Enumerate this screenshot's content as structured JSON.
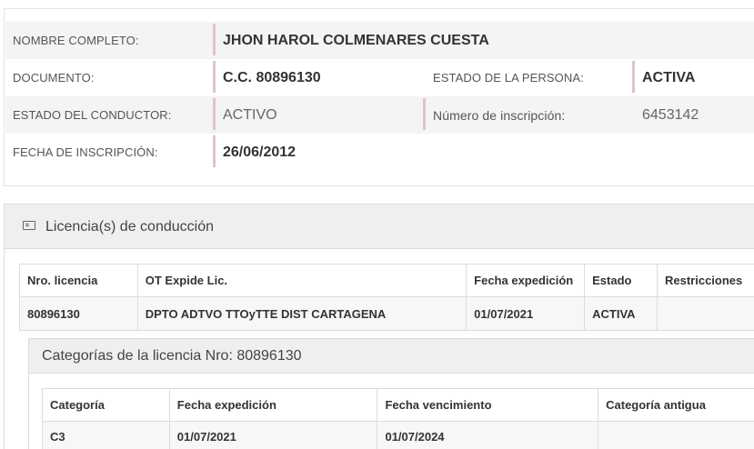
{
  "person": {
    "nombre_label": "NOMBRE COMPLETO:",
    "nombre_value": "JHON HAROL COLMENARES CUESTA",
    "documento_label": "DOCUMENTO:",
    "documento_value": "C.C. 80896130",
    "estado_persona_label": "ESTADO DE LA PERSONA:",
    "estado_persona_value": "ACTIVA",
    "estado_conductor_label": "ESTADO DEL CONDUCTOR:",
    "estado_conductor_value": "ACTIVO",
    "inscripcion_num_label": "Número de inscripción:",
    "inscripcion_num_value": "6453142",
    "fecha_inscripcion_label": "FECHA DE INSCRIPCIÓN:",
    "fecha_inscripcion_value": "26/06/2012"
  },
  "licencias": {
    "title": "Licencia(s) de conducción",
    "icon": "id-card-icon",
    "columns": [
      "Nro. licencia",
      "OT Expide Lic.",
      "Fecha expedición",
      "Estado",
      "Restricciones"
    ],
    "rows": [
      [
        "80896130",
        "DPTO ADTVO TTOyTTE DIST CARTAGENA",
        "01/07/2021",
        "ACTIVA",
        ""
      ]
    ]
  },
  "categorias": {
    "title": "Categorías de la licencia Nro: 80896130",
    "columns": [
      "Categoría",
      "Fecha expedición",
      "Fecha vencimiento",
      "Categoría antigua"
    ],
    "rows": [
      [
        "C3",
        "01/07/2021",
        "01/07/2024",
        ""
      ]
    ]
  },
  "colors": {
    "divider": "#e0c4c6",
    "row_alt": "#f4f4f4",
    "panel_header": "#efefef",
    "border": "#dcdcdc"
  }
}
